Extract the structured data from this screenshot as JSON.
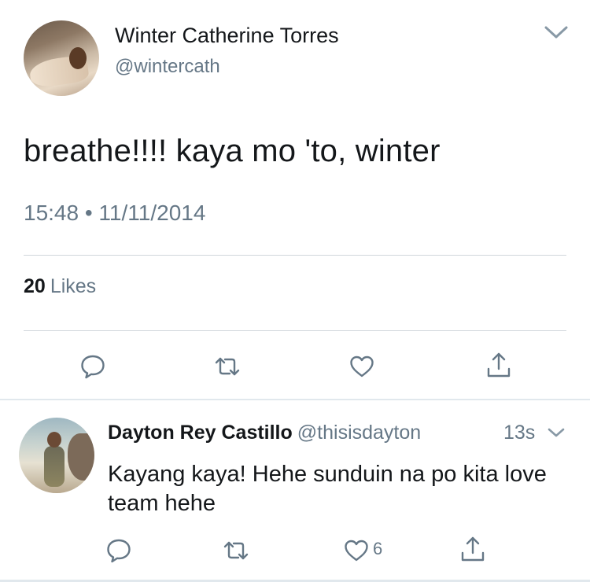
{
  "tweet": {
    "author_name": "Winter Catherine Torres",
    "author_handle": "@wintercath",
    "text": "breathe!!!! kaya mo 'to, winter",
    "timestamp": "15:48 • 11/11/2014",
    "likes_count": "20",
    "likes_label": "Likes",
    "icons": {
      "more": "chevron-down-icon",
      "reply": "reply-icon",
      "retweet": "retweet-icon",
      "like": "heart-icon",
      "share": "share-icon"
    }
  },
  "reply": {
    "author_name": "Dayton Rey Castillo",
    "author_handle": "@thisisdayton",
    "time": "13s",
    "text": "Kayang kaya! Hehe sunduin na po kita love team hehe",
    "like_count": "6"
  },
  "colors": {
    "text_primary": "#14171a",
    "text_secondary": "#657786",
    "icon": "#657786",
    "divider": "#e1e8ed"
  }
}
